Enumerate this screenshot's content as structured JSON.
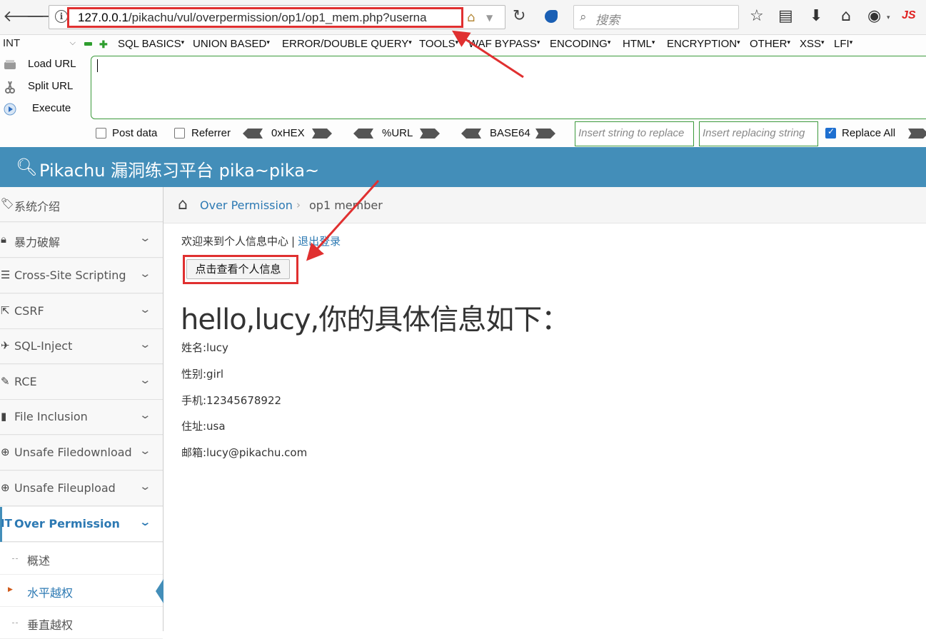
{
  "browser": {
    "url_host": "127.0.0.1",
    "url_path": "/pikachu/vul/overpermission/op1/op1_mem.php?userna",
    "search_placeholder": "搜索",
    "js_badge": "JS",
    "icons": [
      "back-icon",
      "forward-icon",
      "info-icon",
      "home-icon",
      "reload-icon",
      "search-icon",
      "star-icon",
      "reading-list-icon",
      "download-icon",
      "home-icon",
      "globe-icon"
    ]
  },
  "hackbar": {
    "type_select": "INT",
    "menus": [
      "SQL BASICS",
      "UNION BASED",
      "ERROR/DOUBLE QUERY",
      "TOOLS",
      "WAF BYPASS",
      "ENCODING",
      "HTML",
      "ENCRYPTION",
      "OTHER",
      "XSS",
      "LFI"
    ],
    "buttons": [
      "Load URL",
      "Split URL",
      "Execute"
    ],
    "post_data": "Post data",
    "referrer": "Referrer",
    "encoders": [
      "0xHEX",
      "%URL",
      "BASE64"
    ],
    "replace_placeholder": "Insert string to replace",
    "replacing_placeholder": "Insert replacing string",
    "replace_all": "Replace All",
    "replace_all_checked": true
  },
  "header": {
    "title": "Pikachu 漏洞练习平台 pika~pika~",
    "color": "#438eb9"
  },
  "sidebar": {
    "items": [
      {
        "label": "系统介绍",
        "icon": "tag-icon"
      },
      {
        "label": "暴力破解",
        "icon": "lock-icon"
      },
      {
        "label": "Cross-Site Scripting",
        "icon": "list-icon"
      },
      {
        "label": "CSRF",
        "icon": "share-icon"
      },
      {
        "label": "SQL-Inject",
        "icon": "plane-icon"
      },
      {
        "label": "RCE",
        "icon": "pencil-icon"
      },
      {
        "label": "File Inclusion",
        "icon": "file-icon"
      },
      {
        "label": "Unsafe Filedownload",
        "icon": "download-circle-icon"
      },
      {
        "label": "Unsafe Fileupload",
        "icon": "upload-circle-icon"
      },
      {
        "label": "Over Permission",
        "icon": "text-icon"
      }
    ],
    "subitems": [
      "概述",
      "水平越权",
      "垂直越权"
    ],
    "active_sub": "水平越权"
  },
  "breadcrumb": {
    "link": "Over Permission",
    "current": "op1 member"
  },
  "main": {
    "welcome": "欢迎来到个人信息中心",
    "separator": "|",
    "logout": "退出登录",
    "view_button": "点击查看个人信息",
    "greeting": "hello,lucy,你的具体信息如下：",
    "info": {
      "name": "姓名:lucy",
      "gender": "性别:girl",
      "phone": "手机:12345678922",
      "address": "住址:usa",
      "email": "邮箱:lucy@pikachu.com"
    }
  },
  "annotation_color": "#e03030"
}
